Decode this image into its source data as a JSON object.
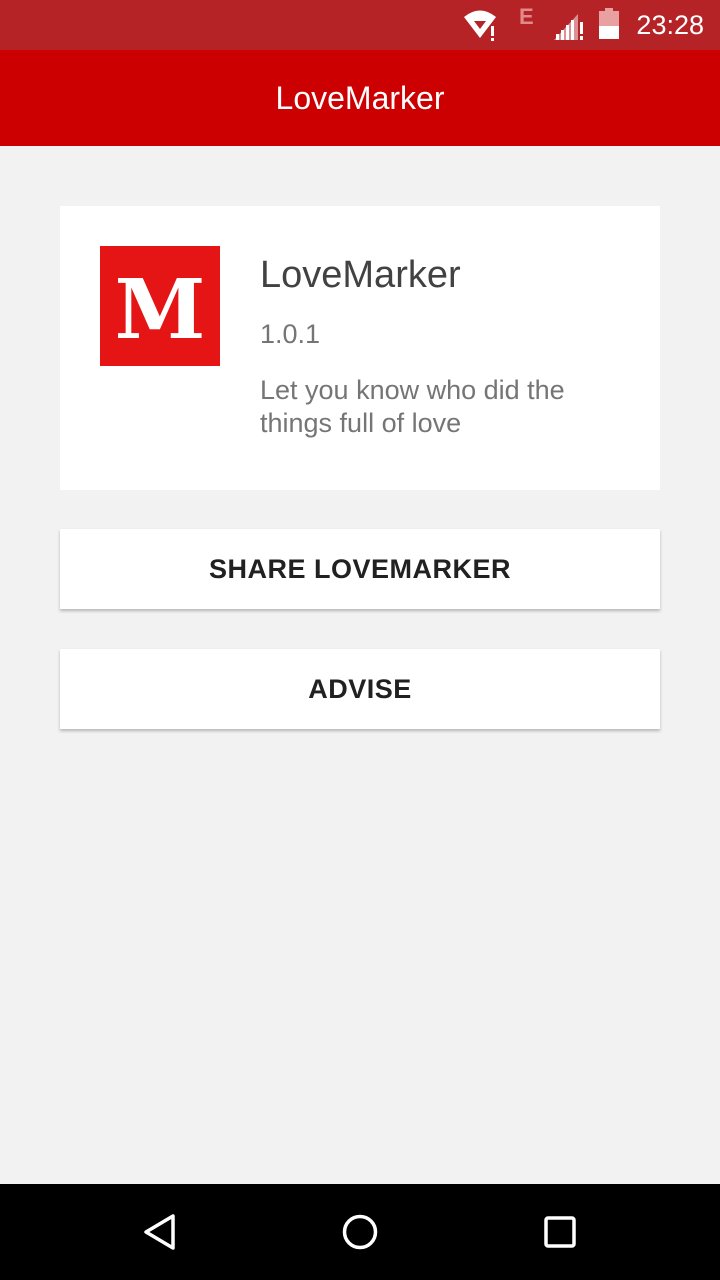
{
  "status_bar": {
    "time": "23:28",
    "network_mark": "E",
    "icons": [
      "wifi-alert-icon",
      "signal-alert-icon",
      "battery-icon"
    ]
  },
  "app_bar": {
    "title": "LoveMarker"
  },
  "info_card": {
    "logo_letter": "M",
    "app_name": "LoveMarker",
    "version": "1.0.1",
    "description": "Let you know who did the things full of love"
  },
  "buttons": {
    "share_label": "SHARE LOVEMARKER",
    "advise_label": "ADVISE"
  },
  "nav_bar": {
    "icons": [
      "back-icon",
      "home-icon",
      "recents-icon"
    ]
  },
  "colors": {
    "status_bar": "#b52326",
    "app_bar": "#cc0000",
    "logo_bg": "#e51515",
    "background": "#f2f2f2"
  }
}
